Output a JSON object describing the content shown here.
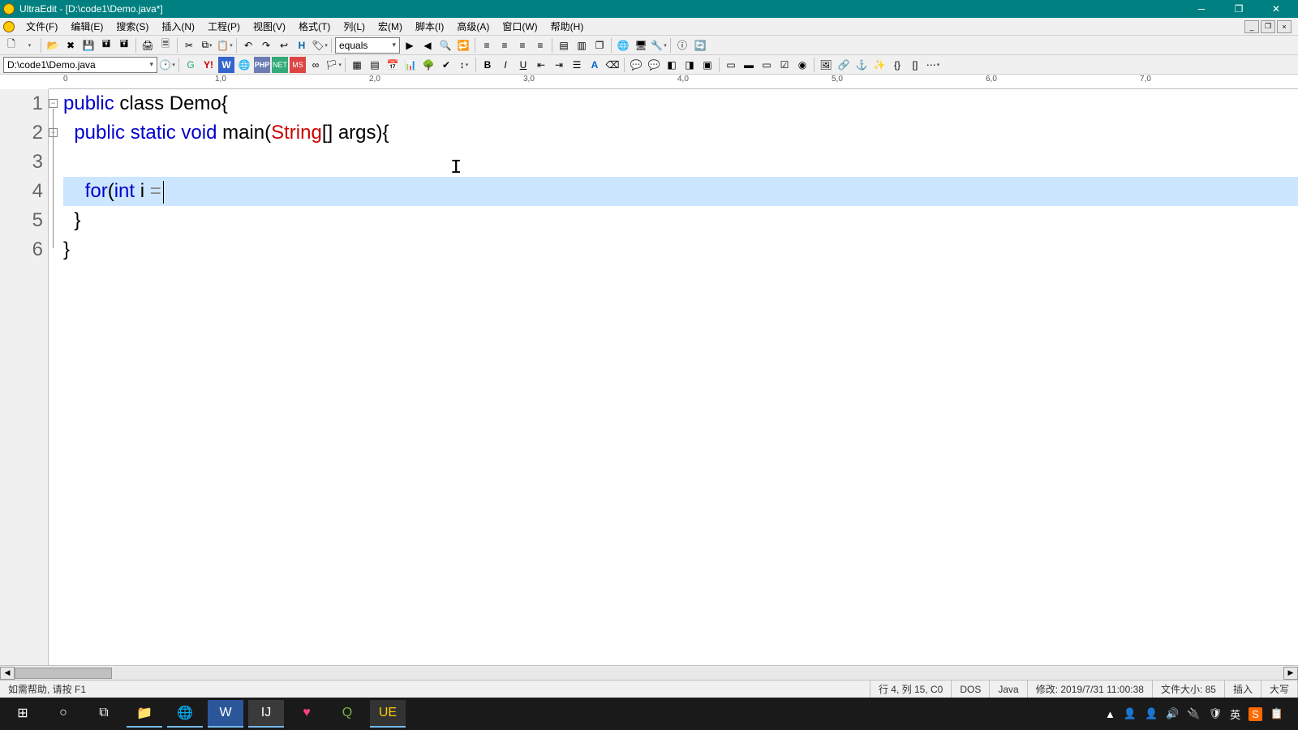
{
  "title": "UltraEdit - [D:\\code1\\Demo.java*]",
  "menus": [
    "文件(F)",
    "编辑(E)",
    "搜索(S)",
    "插入(N)",
    "工程(P)",
    "视图(V)",
    "格式(T)",
    "列(L)",
    "宏(M)",
    "脚本(I)",
    "高级(A)",
    "窗口(W)",
    "帮助(H)"
  ],
  "find_value": "equals",
  "path_value": "D:\\code1\\Demo.java",
  "ruler_labels": [
    "0",
    "1,0",
    "2,0",
    "3,0",
    "4,0",
    "5,0",
    "6,0",
    "7,0"
  ],
  "lines": [
    "1",
    "2",
    "3",
    "4",
    "5",
    "6"
  ],
  "code": {
    "l1_a": "public",
    "l1_b": " class Demo{",
    "l2_a": "  public static void",
    "l2_b": " main(",
    "l2_c": "String",
    "l2_d": "[] args){",
    "l3": "",
    "l4_a": "    for",
    "l4_b": "(",
    "l4_c": "int",
    "l4_d": " i ",
    "l4_e": "=",
    "l5": "  }",
    "l6": "}"
  },
  "status": {
    "help": "如需帮助, 请按 F1",
    "pos": "行 4, 列 15, C0",
    "enc": "DOS",
    "lang": "Java",
    "mod": "修改: 2019/7/31 11:00:38",
    "size": "文件大小: 85",
    "ins": "插入",
    "caps": "大写"
  },
  "icons": {
    "new": "🗋",
    "open": "📂",
    "save": "💾",
    "saveall": "🖬",
    "cut": "✂",
    "copy": "⧉",
    "paste": "📋",
    "undo": "↶",
    "redo": "↷",
    "find": "🔍",
    "print": "🖨",
    "globe": "🌐",
    "yahoo": "Y!",
    "wiki": "W",
    "bold": "B",
    "italic": "I",
    "under": "U",
    "left": "≡",
    "center": "≡",
    "right": "≡",
    "just": "≡",
    "list": "☰",
    "num": "≣",
    "anchor": "⚓",
    "img": "🖼",
    "link": "🔗",
    "help": "?",
    "info": "ⓘ",
    "php": "P",
    "asp": "A"
  },
  "task": {
    "win": "⊞",
    "cortana": "○",
    "taskview": "⧉",
    "explorer": "📁",
    "chrome": "🌐",
    "word": "W",
    "ij": "IJ",
    "heart": "♥",
    "q": "Q",
    "ue": "UE"
  },
  "tray": [
    "▲",
    "🔊",
    "🔌",
    "🛡",
    "英",
    "S",
    "📋"
  ]
}
